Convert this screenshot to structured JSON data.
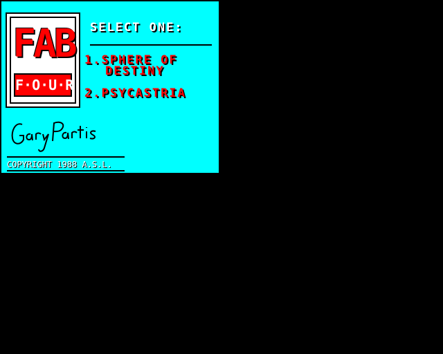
{
  "logo": {
    "title": "FAB",
    "subtitle": "F·O·U·R"
  },
  "menu": {
    "heading": "SELECT ONE:",
    "options": [
      {
        "line1": "1.SPHERE OF",
        "line2": "DESTINY"
      },
      {
        "line1": "2.PSYCASTRIA"
      }
    ]
  },
  "signature": {
    "text": "Gary Partis"
  },
  "footer": {
    "copyright": "COPYRIGHT 1988 A.S.L."
  },
  "colors": {
    "panel_bg": "#00ffff",
    "background": "#000000",
    "option_color": "#ff0000",
    "heading_color": "#ffffff"
  }
}
